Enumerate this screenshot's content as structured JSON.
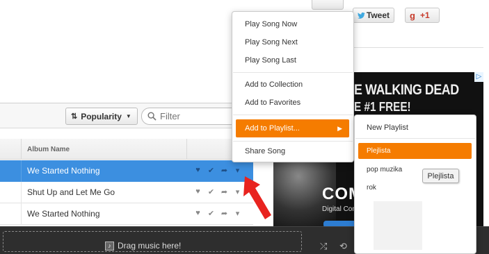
{
  "social": {
    "tweet_label": "Tweet",
    "gplus_mark": "g",
    "gplus_count": "+1"
  },
  "toolbar": {
    "sort_label": "Popularity",
    "filter_placeholder": "Filter"
  },
  "table": {
    "column_album": "Album Name",
    "rows": [
      {
        "album": "We Started Nothing",
        "selected": true
      },
      {
        "album": "Shut Up and Let Me Go",
        "selected": false
      },
      {
        "album": "We Started Nothing",
        "selected": false
      }
    ]
  },
  "ad": {
    "title": "E WALKING DEAD",
    "subtitle": "E #1 FREE!",
    "comm_text": "COM",
    "digital_text": "Digital Com",
    "choices_mark": "▷"
  },
  "bottom": {
    "drag_label": "Drag music here!"
  },
  "context_menu": {
    "items": [
      "Play Song Now",
      "Play Song Next",
      "Play Song Last",
      "Add to Collection",
      "Add to Favorites",
      "Add to Playlist...",
      "Share Song"
    ],
    "active": "Add to Playlist..."
  },
  "playlist_menu": {
    "new_label": "New Playlist",
    "playlists": [
      "Plejlista",
      "pop muzika",
      "rok"
    ],
    "active": "Plejlista"
  },
  "tooltip": {
    "text": "Plejlista"
  },
  "colors": {
    "accent_orange": "#f57c00",
    "selection_blue": "#3c8fe0",
    "arrow_red": "#e8231f"
  }
}
